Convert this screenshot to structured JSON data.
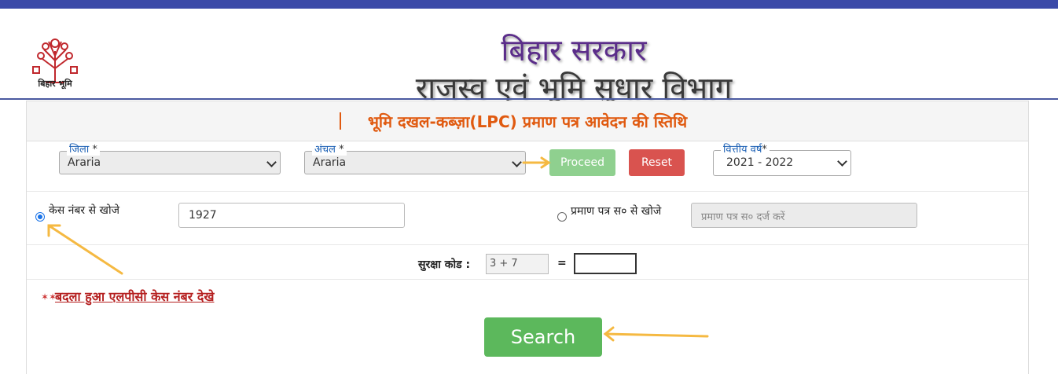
{
  "header": {
    "logo_caption": "बिहार भूमि",
    "title_line1": "बिहार सरकार",
    "title_line2": "राजस्व एवं भूमि सुधार विभाग"
  },
  "form": {
    "title": "भूमि दखल-कब्ज़ा(LPC) प्रमाण पत्र आवेदन की स्तिथि",
    "district": {
      "label": "जिला",
      "required": "*",
      "value": "Araria"
    },
    "circle": {
      "label": "अंचल",
      "required": "*",
      "value": "Araria"
    },
    "proceed_label": "Proceed",
    "reset_label": "Reset",
    "fin_year": {
      "label": "वित्तीय वर्ष",
      "required": "*",
      "value": "2021 - 2022"
    },
    "search_by_case": {
      "label": "केस नंबर से खोजे",
      "value": "1927",
      "selected": true
    },
    "search_by_cert": {
      "label": "प्रमाण पत्र स० से खोजे",
      "placeholder": "प्रमाण पत्र स० दर्ज करें",
      "selected": false
    },
    "captcha": {
      "label": "सुरक्षा कोड :",
      "question": "3 + 7",
      "equals": "=",
      "answer": ""
    },
    "changed_case_link": "बदला हुआ एलपीसी केस नंबर देखे",
    "search_label": "Search"
  },
  "colors": {
    "top_bar": "#3b4aa8",
    "title_orange": "#e05a10",
    "label_blue": "#1a5fb4",
    "proceed_green": "#8fd08f",
    "reset_red": "#d9534f",
    "search_green": "#5cb85c",
    "annotation_arrow": "#f5b942"
  },
  "icons": [
    "bihar-emblem-icon",
    "chevron-down-icon",
    "new-flag-icon",
    "annotation-arrow-icon"
  ]
}
